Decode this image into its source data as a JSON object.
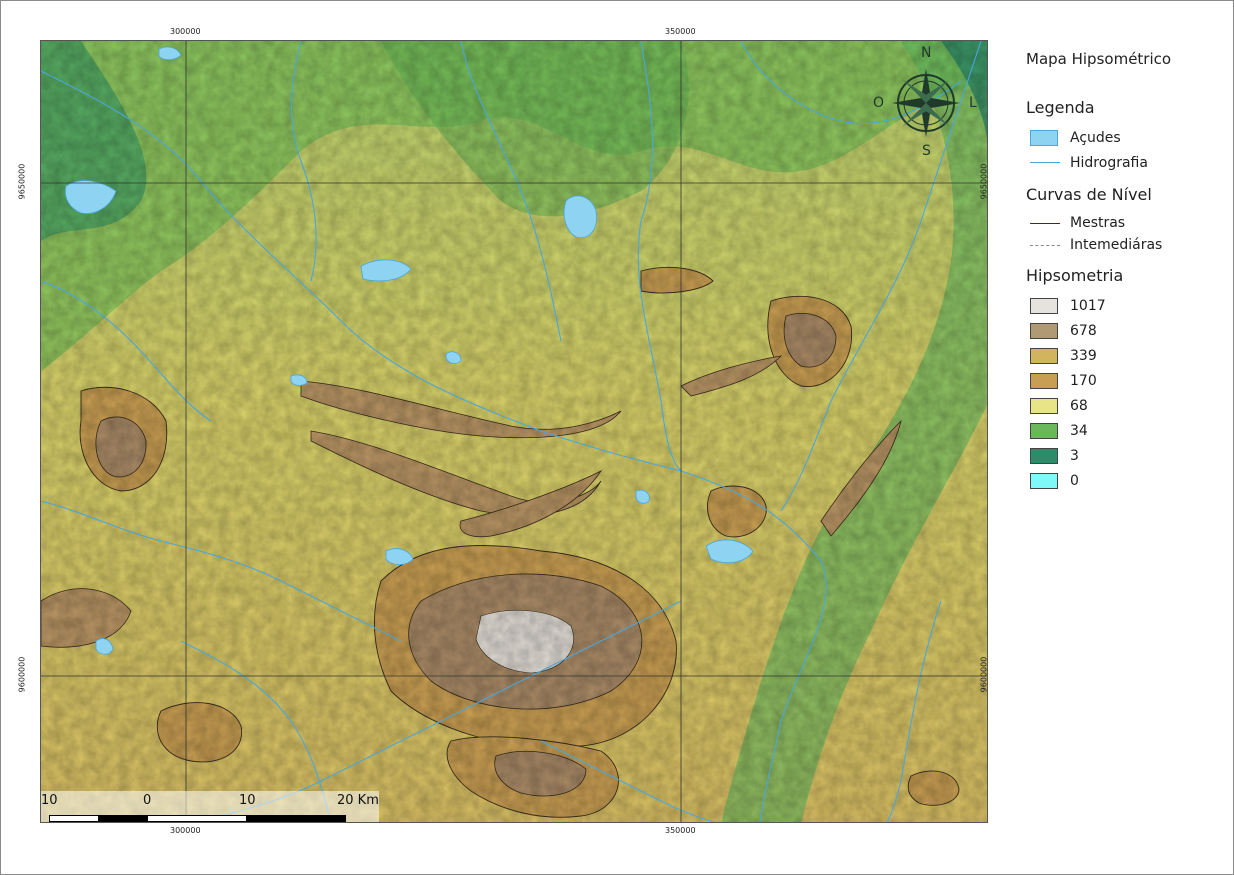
{
  "title": "Mapa Hipsométrico",
  "coords": {
    "top": [
      "300000",
      "350000"
    ],
    "bottom": [
      "300000",
      "350000"
    ],
    "left": [
      "9650000",
      "9600000"
    ],
    "right": [
      "9650000",
      "9600000"
    ]
  },
  "compass": {
    "n": "N",
    "s": "S",
    "e": "L",
    "w": "O"
  },
  "legend": {
    "header": "Legenda",
    "water": "Açudes",
    "hydro": "Hidrografia",
    "contours_header": "Curvas de Nível",
    "master": "Mestras",
    "intermediate": "Intemediáras",
    "hypso_header": "Hipsometria",
    "classes": [
      {
        "label": "1017",
        "color": "#e6e2de"
      },
      {
        "label": "678",
        "color": "#b09a74"
      },
      {
        "label": "339",
        "color": "#d2b45e"
      },
      {
        "label": "170",
        "color": "#c89e52"
      },
      {
        "label": "68",
        "color": "#e8e488"
      },
      {
        "label": "34",
        "color": "#6ab85a"
      },
      {
        "label": "3",
        "color": "#2e8c6a"
      },
      {
        "label": "0",
        "color": "#7ef8f8"
      }
    ],
    "water_color": "#8ed4f2",
    "hydro_color": "#4aa6dc"
  },
  "scale": {
    "labels": [
      "10",
      "0",
      "10",
      "20 Km"
    ]
  }
}
